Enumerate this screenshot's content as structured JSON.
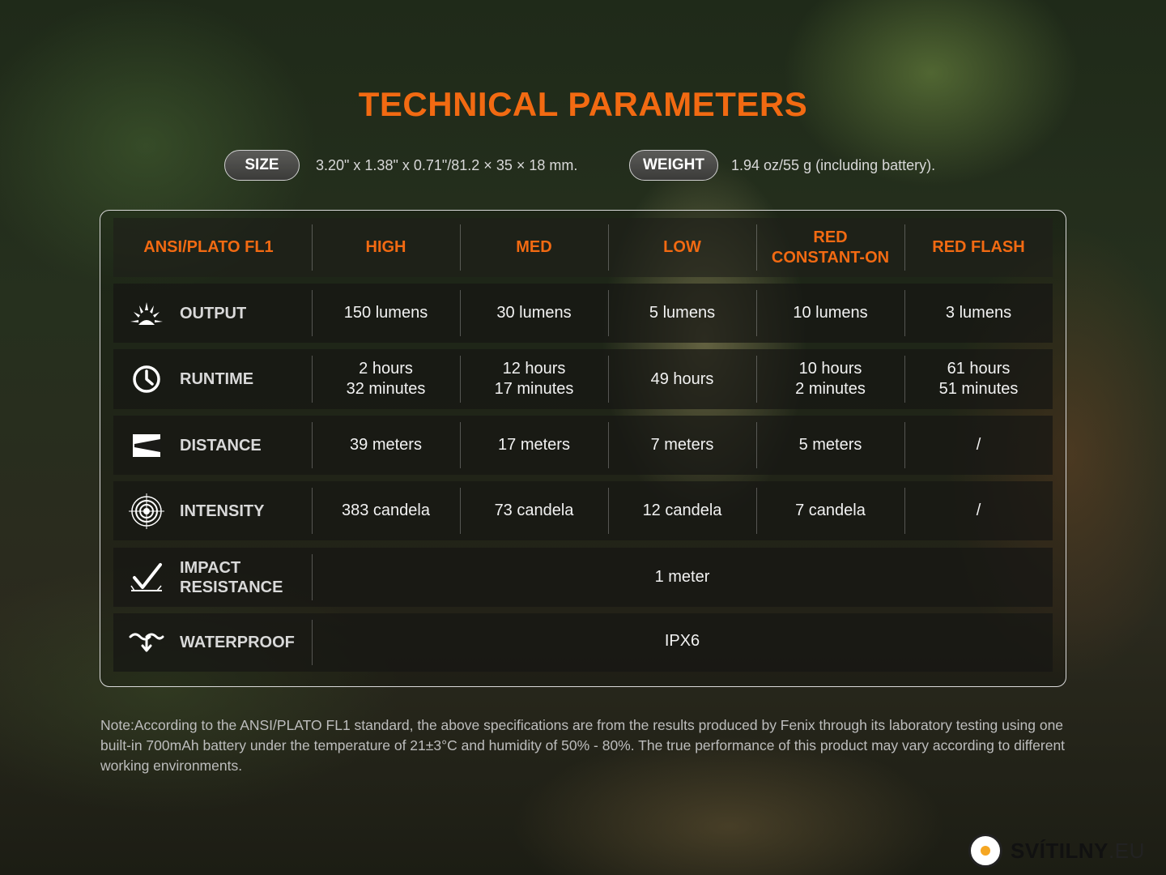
{
  "title": "TECHNICAL PARAMETERS",
  "size": {
    "label": "SIZE",
    "value": "3.20\" x 1.38\" x 0.71\"/81.2 × 35 × 18 mm."
  },
  "weight": {
    "label": "WEIGHT",
    "value": "1.94 oz/55 g (including battery)."
  },
  "table": {
    "headers": [
      "ANSI/PLATO FL1",
      "HIGH",
      "MED",
      "LOW",
      "RED\nCONSTANT-ON",
      "RED FLASH"
    ],
    "rows": [
      {
        "icon": "output-icon",
        "label": "OUTPUT",
        "values": [
          "150 lumens",
          "30 lumens",
          "5 lumens",
          "10 lumens",
          "3 lumens"
        ]
      },
      {
        "icon": "clock-icon",
        "label": "RUNTIME",
        "values": [
          "2 hours\n32 minutes",
          "12 hours\n17 minutes",
          "49 hours",
          "10 hours\n2 minutes",
          "61 hours\n51 minutes"
        ]
      },
      {
        "icon": "beam-distance-icon",
        "label": "DISTANCE",
        "values": [
          "39 meters",
          "17 meters",
          "7 meters",
          "5 meters",
          "/"
        ]
      },
      {
        "icon": "target-icon",
        "label": "INTENSITY",
        "values": [
          "383 candela",
          "73 candela",
          "12 candela",
          "7 candela",
          "/"
        ]
      },
      {
        "icon": "impact-icon",
        "label": "IMPACT\nRESISTANCE",
        "span_value": "1 meter"
      },
      {
        "icon": "waterproof-icon",
        "label": "WATERPROOF",
        "span_value": "IPX6"
      }
    ]
  },
  "note": "Note:According to the ANSI/PLATO FL1 standard, the above specifications are from the results produced by Fenix through its laboratory testing using one built-in 700mAh battery under the temperature of 21±3°C and humidity of 50% - 80%. The true performance of this product may vary according to different working environments.",
  "logo": {
    "name": "SVÍTILNY",
    "suffix": ".EU"
  },
  "colors": {
    "accent": "#f26a12",
    "logo_dot": "#f5a623"
  }
}
